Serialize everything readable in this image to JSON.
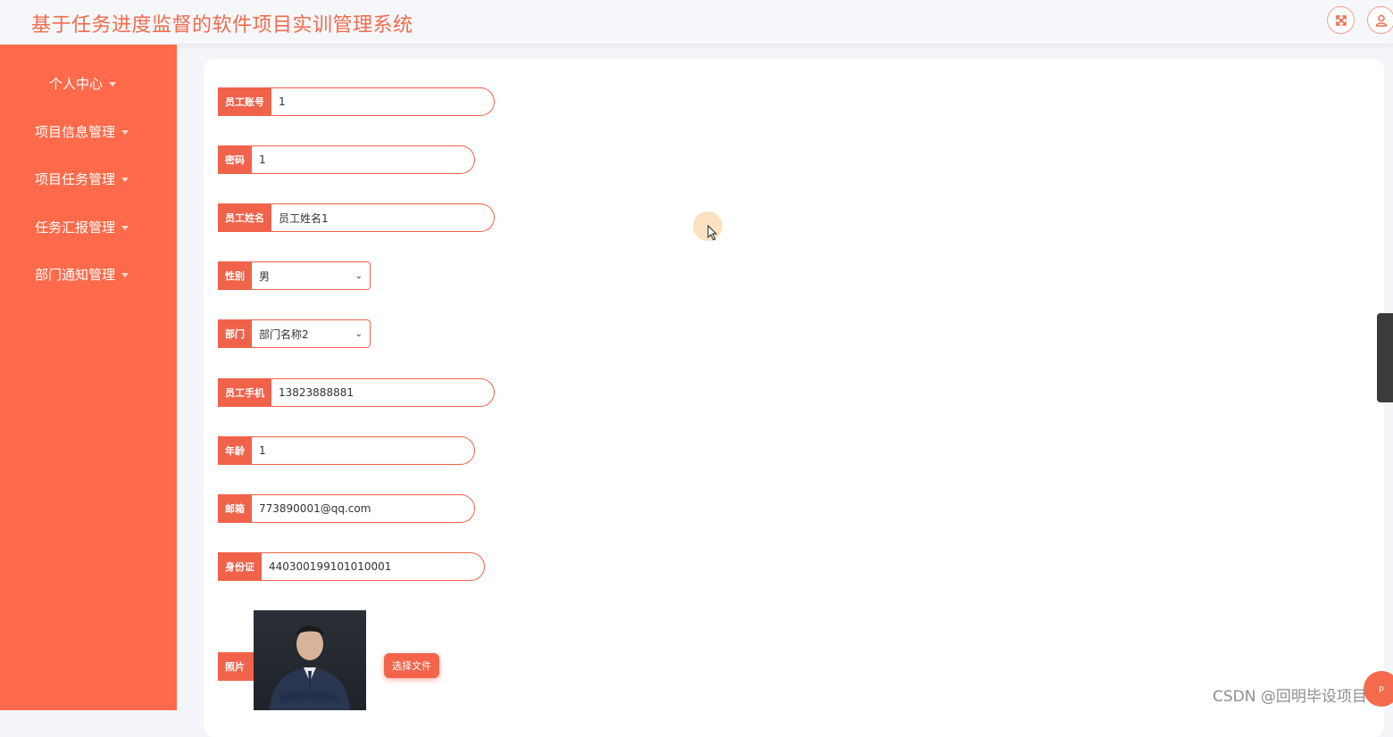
{
  "header": {
    "title": "基于任务进度监督的软件项目实训管理系统"
  },
  "sidebar": {
    "items": [
      {
        "label": "个人中心"
      },
      {
        "label": "项目信息管理"
      },
      {
        "label": "项目任务管理"
      },
      {
        "label": "任务汇报管理"
      },
      {
        "label": "部门通知管理"
      }
    ]
  },
  "form": {
    "account": {
      "label": "员工账号",
      "value": "1"
    },
    "password": {
      "label": "密码",
      "value": "1"
    },
    "name": {
      "label": "员工姓名",
      "value": "员工姓名1"
    },
    "gender": {
      "label": "性别",
      "value": "男"
    },
    "department": {
      "label": "部门",
      "value": "部门名称2"
    },
    "phone": {
      "label": "员工手机",
      "value": "13823888881"
    },
    "age": {
      "label": "年龄",
      "value": "1"
    },
    "email": {
      "label": "邮箱",
      "value": "773890001@qq.com"
    },
    "idcard": {
      "label": "身份证",
      "value": "440300199101010001"
    },
    "photo": {
      "label": "照片",
      "button": "选择文件"
    }
  },
  "floating": {
    "label": "p"
  },
  "watermark": "CSDN @回明毕设项目",
  "colors": {
    "accent": "#ff6a4a",
    "title": "#f36b4c"
  }
}
